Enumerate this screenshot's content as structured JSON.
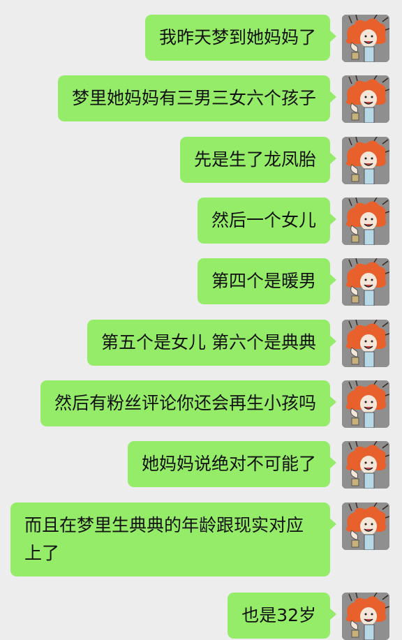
{
  "chat": {
    "messages": [
      {
        "text": "我昨天梦到她妈妈了",
        "sender": "me",
        "avatar_icon": "cartoon-avatar-icon"
      },
      {
        "text": "梦里她妈妈有三男三女六个孩子",
        "sender": "me",
        "avatar_icon": "cartoon-avatar-icon"
      },
      {
        "text": "先是生了龙凤胎",
        "sender": "me",
        "avatar_icon": "cartoon-avatar-icon"
      },
      {
        "text": "然后一个女儿",
        "sender": "me",
        "avatar_icon": "cartoon-avatar-icon"
      },
      {
        "text": "第四个是暖男",
        "sender": "me",
        "avatar_icon": "cartoon-avatar-icon"
      },
      {
        "text": "第五个是女儿 第六个是典典",
        "sender": "me",
        "avatar_icon": "cartoon-avatar-icon"
      },
      {
        "text": "然后有粉丝评论你还会再生小孩吗",
        "sender": "me",
        "avatar_icon": "cartoon-avatar-icon"
      },
      {
        "text": "她妈妈说绝对不可能了",
        "sender": "me",
        "avatar_icon": "cartoon-avatar-icon"
      },
      {
        "text": "而且在梦里生典典的年龄跟现实对应上了",
        "sender": "me",
        "avatar_icon": "cartoon-avatar-icon"
      },
      {
        "text": "也是32岁",
        "sender": "me",
        "avatar_icon": "cartoon-avatar-icon"
      }
    ]
  },
  "colors": {
    "background": "#ededed",
    "bubble_green": "#95ec69",
    "avatar_hair": "#e8612c"
  }
}
